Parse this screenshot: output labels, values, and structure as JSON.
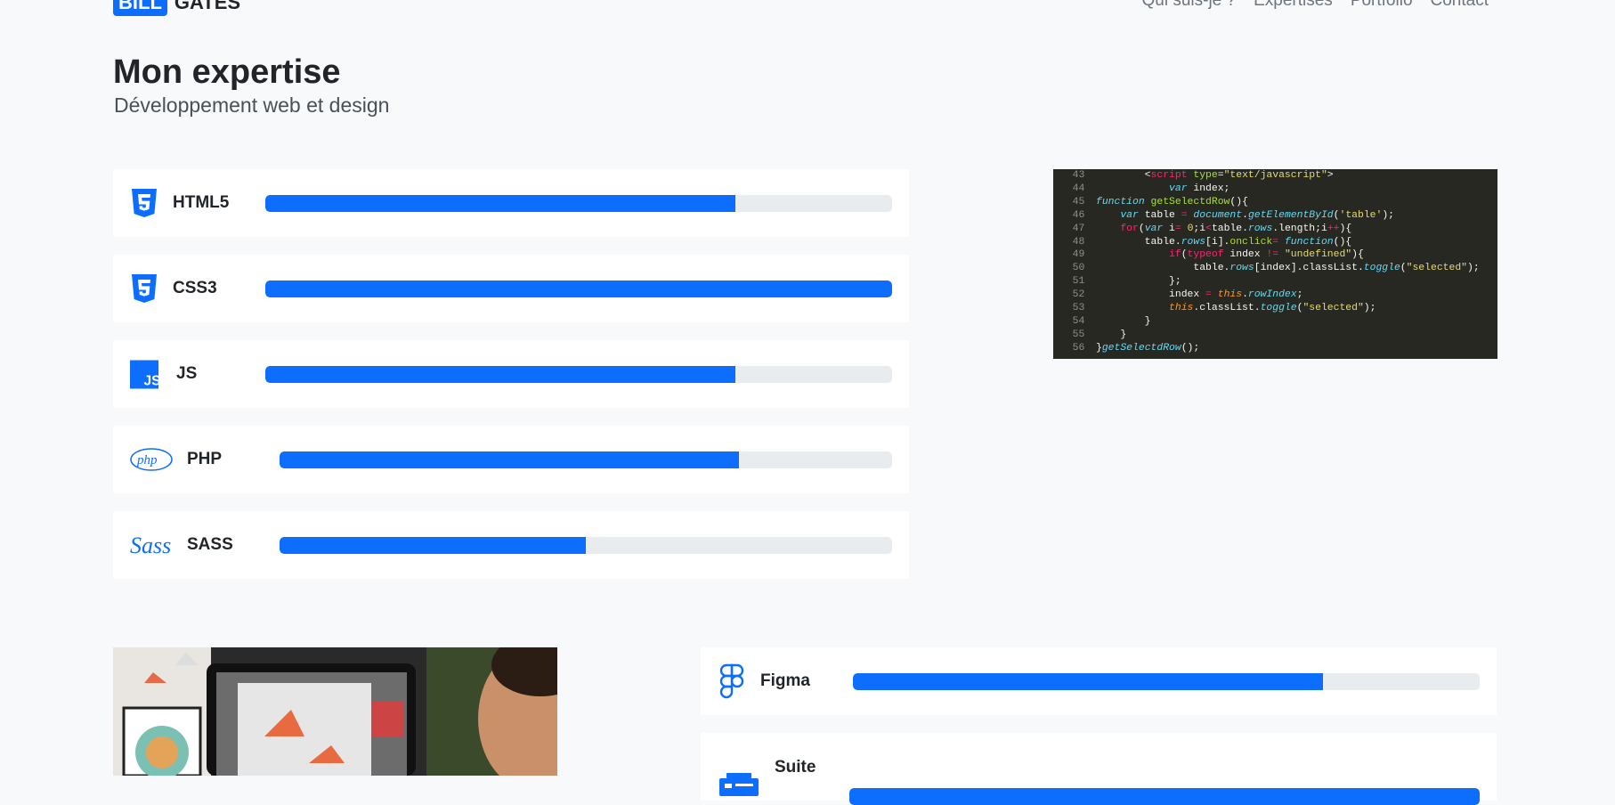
{
  "brand": {
    "badge": "BILL",
    "name": "GATES"
  },
  "nav": [
    "Qui suis-je ?",
    "Expertises",
    "Portfolio",
    "Contact"
  ],
  "header": {
    "title": "Mon expertise",
    "subtitle": "Développement web et design"
  },
  "skills": [
    {
      "label": "HTML5",
      "icon": "html5-icon",
      "level": 0.75
    },
    {
      "label": "CSS3",
      "icon": "css3-icon",
      "level": 1.0
    },
    {
      "label": "JS",
      "icon": "js-icon",
      "level": 0.75
    },
    {
      "label": "PHP",
      "icon": "php-icon",
      "level": 0.75
    },
    {
      "label": "SASS",
      "icon": "sass-icon",
      "level": 0.5
    }
  ],
  "design_skills": [
    {
      "label": "Figma",
      "icon": "figma-icon",
      "level": 0.75
    },
    {
      "label": "Suite",
      "icon": "adobe-suite-icon",
      "level": 1.0
    }
  ],
  "colors": {
    "accent": "#0d6efd",
    "bar_bg": "#e9ecef",
    "code_bg": "#272822"
  }
}
